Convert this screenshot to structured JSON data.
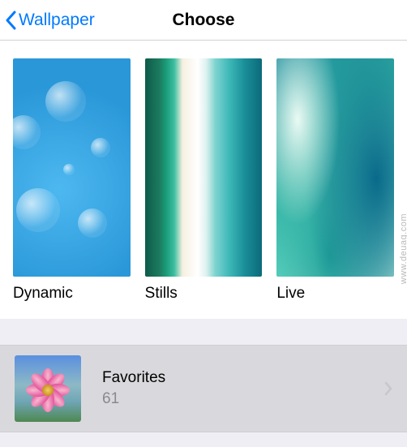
{
  "nav": {
    "back_label": "Wallpaper",
    "title": "Choose"
  },
  "wallpaper_categories": [
    {
      "key": "dynamic",
      "label": "Dynamic"
    },
    {
      "key": "stills",
      "label": "Stills"
    },
    {
      "key": "live",
      "label": "Live"
    }
  ],
  "albums": [
    {
      "name": "Favorites",
      "count": "61",
      "thumb": "pink-dahlia"
    }
  ],
  "watermark": "www.deuag.com"
}
